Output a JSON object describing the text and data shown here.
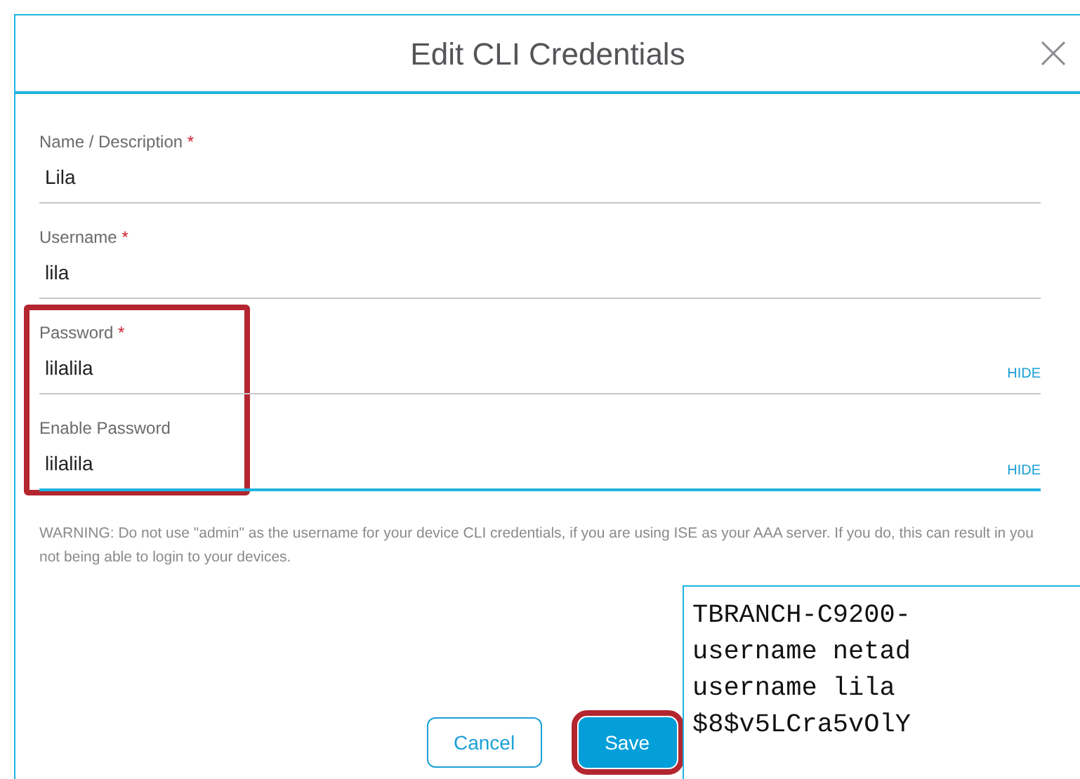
{
  "dialog": {
    "title": "Edit CLI Credentials"
  },
  "fields": [
    {
      "label": "Name / Description",
      "required_mark": "*",
      "value": "Lila",
      "focused": false,
      "highlighted": false
    },
    {
      "label": "Username",
      "required_mark": "*",
      "value": "lila",
      "focused": false,
      "highlighted": false
    },
    {
      "label": "Password",
      "required_mark": "*",
      "value": "lilalila",
      "toggle": "HIDE",
      "focused": false,
      "highlighted": true
    },
    {
      "label": "Enable Password",
      "value": "lilalila",
      "toggle": "HIDE",
      "focused": true,
      "highlighted": true
    }
  ],
  "warning": "WARNING: Do not use \"admin\" as the username for your device CLI credentials, if you are using ISE as your AAA server. If you do, this can result in you not being able to login to your devices.",
  "buttons": [
    {
      "label": "Cancel",
      "kind": "secondary",
      "highlighted": false
    },
    {
      "label": "Save",
      "kind": "primary",
      "highlighted": true
    }
  ],
  "terminal": {
    "lines": [
      "TBRANCH-C9200-",
      "username netad",
      "username lila",
      "$8$v5LCra5vOlY"
    ]
  }
}
